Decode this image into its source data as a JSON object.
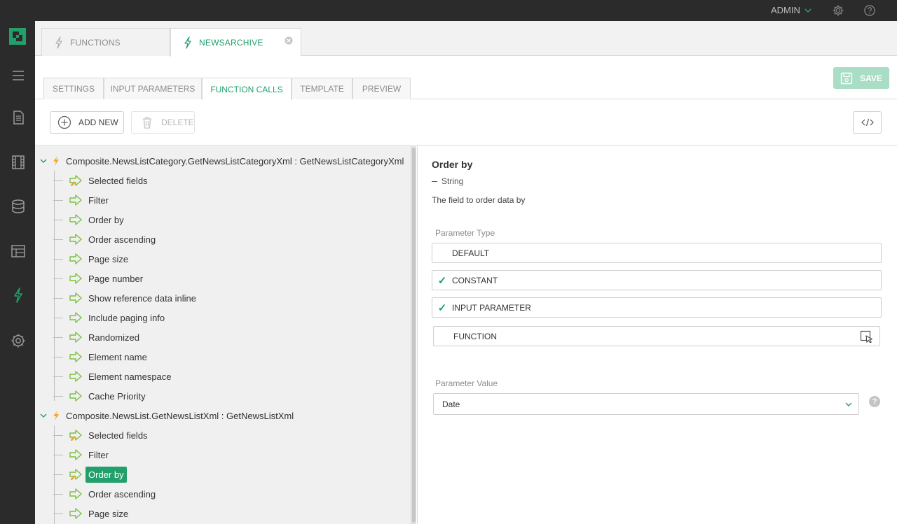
{
  "header": {
    "user_label": "ADMIN"
  },
  "doc_tabs": [
    {
      "label": "FUNCTIONS"
    },
    {
      "label": "NEWSARCHIVE"
    }
  ],
  "sub_tabs": [
    {
      "label": "SETTINGS"
    },
    {
      "label": "INPUT PARAMETERS"
    },
    {
      "label": "FUNCTION CALLS"
    },
    {
      "label": "TEMPLATE"
    },
    {
      "label": "PREVIEW"
    }
  ],
  "active_sub_tab": "FUNCTION CALLS",
  "save_label": "SAVE",
  "toolbar": {
    "add_label": "ADD NEW",
    "delete_label": "DELETE"
  },
  "tree": {
    "group1": {
      "title": "Composite.NewsListCategory.GetNewsListCategoryXml : GetNewsListCategoryXml",
      "items": [
        "Selected fields",
        "Filter",
        "Order by",
        "Order ascending",
        "Page size",
        "Page number",
        "Show reference data inline",
        "Include paging info",
        "Randomized",
        "Element name",
        "Element namespace",
        "Cache Priority"
      ]
    },
    "group2": {
      "title": "Composite.NewsList.GetNewsListXml : GetNewsListXml",
      "items": [
        "Selected fields",
        "Filter",
        "Order by",
        "Order ascending",
        "Page size"
      ]
    },
    "selected_item": "Order by"
  },
  "detail": {
    "title": "Order by",
    "type": "String",
    "description": "The field to order data by",
    "param_type_label": "Parameter Type",
    "options": [
      {
        "label": "DEFAULT",
        "checked": false
      },
      {
        "label": "CONSTANT",
        "checked": true
      },
      {
        "label": "INPUT PARAMETER",
        "checked": true
      },
      {
        "label": "FUNCTION",
        "checked": false
      }
    ],
    "check_glyph": "✓",
    "param_value_label": "Parameter Value",
    "param_value": "Date",
    "help_glyph": "?"
  },
  "colors": {
    "accent": "#22a06b",
    "sidebar": "#2b2b2b",
    "bolt": "#f0a92b"
  }
}
